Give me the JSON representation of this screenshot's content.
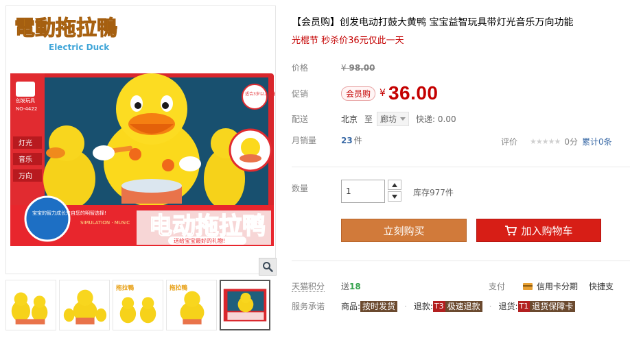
{
  "gallery": {
    "logo_text": "電動拖拉鴨",
    "logo_subtext": "Electric Duck",
    "box_brand": "创发玩具",
    "box_model": "NO-4422",
    "box_age": "适合3岁以上儿童",
    "box_features": [
      "灯光",
      "音乐",
      "万向"
    ],
    "box_title": "电动拖拉鸭",
    "box_slogan": "送给宝宝最好的礼物!",
    "box_bubble": "宝宝的智力成长来自您的明智选择!",
    "zoom_icon": "magnifier-icon"
  },
  "thumbnails": [
    {
      "name": "thumb-1"
    },
    {
      "name": "thumb-2"
    },
    {
      "name": "thumb-3"
    },
    {
      "name": "thumb-4"
    },
    {
      "name": "thumb-5",
      "active": true
    }
  ],
  "product": {
    "title": "【会员购】创发电动打鼓大黄鸭 宝宝益智玩具带灯光音乐万向功能",
    "subtitle": "光棍节 秒杀价36元仅此一天"
  },
  "price": {
    "label": "价格",
    "old_currency": "¥",
    "old_value": "98.00"
  },
  "promo": {
    "label": "促销",
    "badge": "会员购",
    "currency": "¥",
    "value": "36.00"
  },
  "shipping": {
    "label": "配送",
    "from": "北京",
    "to_word": "至",
    "to": "廊坊",
    "fee": "快递: 0.00"
  },
  "sales": {
    "label": "月销量",
    "count": "23",
    "unit": "件",
    "rating_label": "评价",
    "stars": "★★★★★",
    "score": "0分",
    "cumulative": "累计0条"
  },
  "quantity": {
    "label": "数量",
    "value": "1",
    "stock": "库存977件"
  },
  "buttons": {
    "buy": "立刻购买",
    "cart": "加入购物车"
  },
  "points": {
    "label": "天猫积分",
    "send": "送",
    "value": "18",
    "pay_label": "支付",
    "pay_method": "信用卡分期",
    "fast_pay": "快捷支"
  },
  "service": {
    "label": "服务承诺",
    "goods_label": "商品:",
    "goods_tag": "按时发货",
    "refund_label": "退款:",
    "refund_prefix": "T3",
    "refund_tag": "极速退款",
    "return_label": "退货:",
    "return_prefix": "T1",
    "return_tag": "退货保障卡"
  },
  "colors": {
    "price_red": "#c40000",
    "buy_orange": "#d17a3a",
    "cart_red": "#d71e16",
    "link_blue": "#3a6aa6",
    "points_green": "#35a34d"
  }
}
